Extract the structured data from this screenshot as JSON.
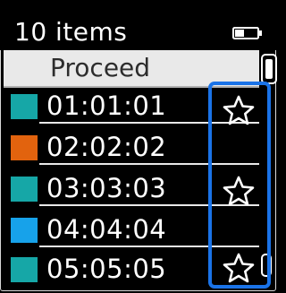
{
  "header": {
    "item_count": "10 items",
    "battery_icon": "battery-icon"
  },
  "action": {
    "proceed_label": "Proceed"
  },
  "colors": {
    "teal": "#16a7a7",
    "orange": "#e2630e",
    "blue": "#17a2ea",
    "highlight": "#1a73e8"
  },
  "rows": [
    {
      "time": "01:01:01",
      "swatch": "#16a7a7",
      "starred": true
    },
    {
      "time": "02:02:02",
      "swatch": "#e2630e",
      "starred": false
    },
    {
      "time": "03:03:03",
      "swatch": "#16a7a7",
      "starred": true
    },
    {
      "time": "04:04:04",
      "swatch": "#17a2ea",
      "starred": false
    },
    {
      "time": "05:05:05",
      "swatch": "#16a7a7",
      "starred": true
    }
  ]
}
